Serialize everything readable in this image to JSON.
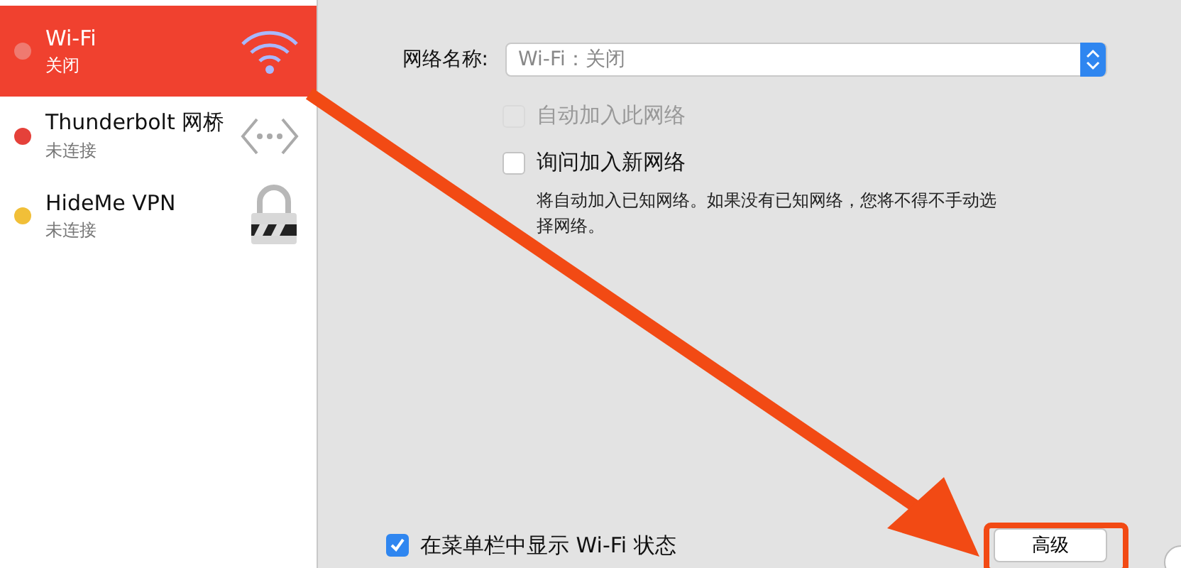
{
  "sidebar": {
    "items": [
      {
        "name": "Wi-Fi",
        "status": "关闭",
        "color": "#ef7a70",
        "selected": true,
        "kind": "wifi"
      },
      {
        "name": "Thunderbolt 网桥",
        "status": "未连接",
        "color": "#e5413a",
        "selected": false,
        "kind": "bridge"
      },
      {
        "name": "HideMe VPN",
        "status": "未连接",
        "color": "#f1bf38",
        "selected": false,
        "kind": "lock"
      }
    ]
  },
  "network_name": {
    "label": "网络名称:",
    "value": "Wi-Fi：关闭"
  },
  "options": [
    {
      "label": "自动加入此网络",
      "checked": false,
      "disabled": true
    },
    {
      "label": "询问加入新网络",
      "checked": false,
      "disabled": false
    }
  ],
  "description": "将自动加入已知网络。如果没有已知网络，您将不得不手动选择网络。",
  "menu_bar_option": {
    "label": "在菜单栏中显示 Wi-Fi 状态",
    "checked": true
  },
  "advanced_button": "高级"
}
